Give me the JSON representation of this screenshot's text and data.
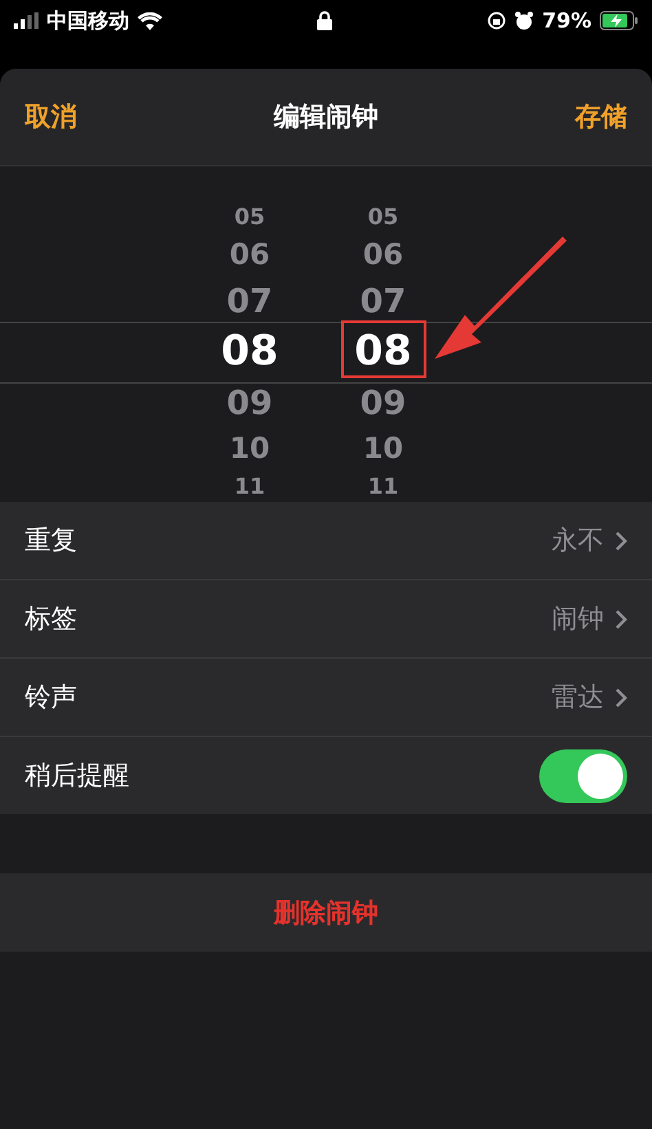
{
  "status_bar": {
    "carrier": "中国移动",
    "battery": "79%"
  },
  "header": {
    "cancel": "取消",
    "title": "编辑闹钟",
    "save": "存储"
  },
  "picker": {
    "columns": [
      {
        "values": [
          {
            "text": "05",
            "selected": false
          },
          {
            "text": "06",
            "selected": false
          },
          {
            "text": "07",
            "selected": false
          },
          {
            "text": "08",
            "selected": true
          },
          {
            "text": "09",
            "selected": false
          },
          {
            "text": "10",
            "selected": false
          },
          {
            "text": "11",
            "selected": false
          }
        ]
      },
      {
        "values": [
          {
            "text": "05",
            "selected": false
          },
          {
            "text": "06",
            "selected": false
          },
          {
            "text": "07",
            "selected": false
          },
          {
            "text": "08",
            "selected": true
          },
          {
            "text": "09",
            "selected": false
          },
          {
            "text": "10",
            "selected": false
          },
          {
            "text": "11",
            "selected": false
          }
        ]
      }
    ]
  },
  "settings": [
    {
      "kind": "link",
      "label": "重复",
      "value": "永不"
    },
    {
      "kind": "link",
      "label": "标签",
      "value": "闹钟"
    },
    {
      "kind": "link",
      "label": "铃声",
      "value": "雷达"
    },
    {
      "kind": "toggle",
      "label": "稍后提醒",
      "on": true
    }
  ],
  "delete_button": "删除闹钟"
}
